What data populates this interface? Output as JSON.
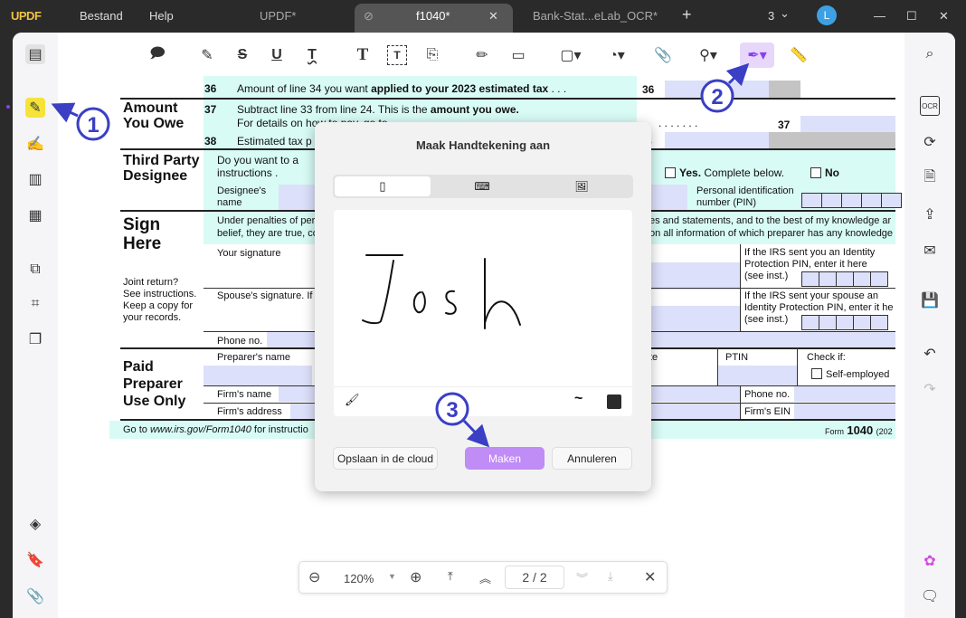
{
  "app": {
    "logo": "UPDF",
    "menu": [
      "Bestand",
      "Help"
    ],
    "tabs": [
      {
        "label": "UPDF*"
      },
      {
        "label": "f1040*"
      },
      {
        "label": "Bank-Stat...eLab_OCR*"
      }
    ],
    "window_count": "3",
    "avatar": "L"
  },
  "form": {
    "l36": {
      "num": "36",
      "text": "Amount of line 34 you want ",
      "bold": "applied to your 2023 estimated tax",
      "dots": " .  .  .",
      "box": "36"
    },
    "amount_heading": [
      "Amount",
      "You Owe"
    ],
    "l37": {
      "num": "37",
      "text": "Subtract line 33 from line 24. This is the ",
      "bold": "amount you owe.",
      "text2": "For details on how to pay, go to",
      "dots": ".  .  .  .  .  .  .",
      "box": "37"
    },
    "l38": {
      "num": "38",
      "text": "Estimated tax p",
      "box": "8"
    },
    "tpd_heading": [
      "Third Party",
      "Designee"
    ],
    "tpd_q": "Do you want to a",
    "tpd_q2": "instructions     .",
    "yes": "Yes.",
    "yes_rest": " Complete below.",
    "no": "No",
    "designee_name": [
      "Designee's",
      "name"
    ],
    "pin_label": [
      "Personal identification",
      "number (PIN)"
    ],
    "sign_heading": [
      "Sign",
      "Here"
    ],
    "penalty1": "Under penalties of per",
    "penalty2": "belief, they are true, co",
    "penalty1r": "es and statements, and to the best of my knowledge ar",
    "penalty2r": "on all information of which preparer has any knowledge",
    "your_sig": "Your signature",
    "joint": [
      "Joint return?",
      "See instructions.",
      "Keep a copy for",
      "your records."
    ],
    "spouse_sig": "Spouse's signature. If",
    "ip1": [
      "If the IRS sent you an Identity",
      "Protection PIN, enter it here",
      "(see inst.)"
    ],
    "ip2": [
      "If the IRS sent your spouse an",
      "Identity Protection PIN, enter it he",
      "(see inst.)"
    ],
    "phone": "Phone no.",
    "paid_heading": [
      "Paid",
      "Preparer",
      "Use Only"
    ],
    "preparer_name": "Preparer's name",
    "date_partial": "te",
    "ptin": "PTIN",
    "check_if": "Check if:",
    "self_employed": "Self-employed",
    "firm_name": "Firm's name",
    "firm_phone": "Phone no.",
    "firm_address": "Firm's address",
    "firm_ein": "Firm's EIN",
    "footer_pre": "Go to ",
    "footer_link": "www.irs.gov/Form1040",
    "footer_post": " for instructio",
    "form_label": "Form",
    "form_num": "1040",
    "form_year": "(202"
  },
  "dialog": {
    "title": "Maak Handtekening aan",
    "tabs": [
      "mouse-icon",
      "keyboard-icon",
      "image-icon"
    ],
    "signature": "Josh",
    "save_cloud": "Opslaan in de cloud",
    "create": "Maken",
    "cancel": "Annuleren",
    "accent": "#c08cf5"
  },
  "bottombar": {
    "zoom": "120%",
    "page": "2 / 2"
  },
  "annotations": [
    "1",
    "2",
    "3"
  ]
}
